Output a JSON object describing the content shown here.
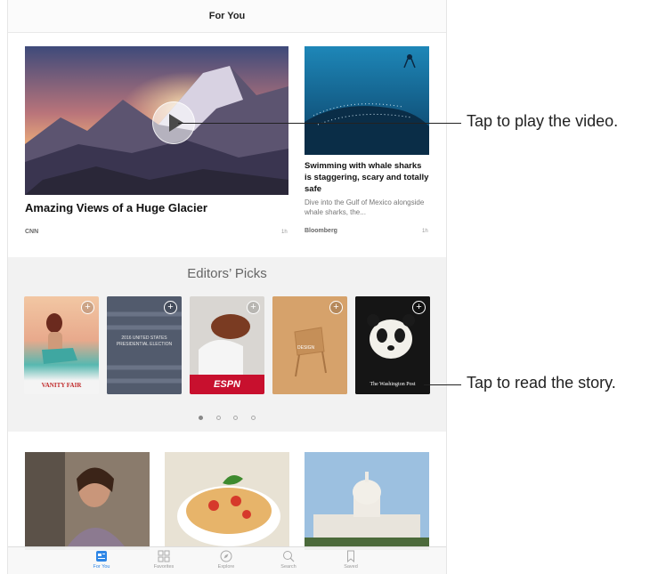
{
  "header": {
    "title": "For You"
  },
  "hero": {
    "title": "Amazing Views of a Huge Glacier",
    "source": "CNN",
    "time": "1h"
  },
  "side_story": {
    "title": "Swimming with whale sharks is staggering, scary and totally safe",
    "excerpt": "Dive into the Gulf of Mexico alongside whale sharks, the...",
    "source": "Bloomberg",
    "time": "1h"
  },
  "editors_picks": {
    "title": "Editors’ Picks",
    "covers": [
      {
        "brand": "VANITY FAIR"
      },
      {
        "brand": "2016 UNITED STATES PRESIDENTIAL ELECTION"
      },
      {
        "brand": "ESPN"
      },
      {
        "brand": "DESIGN"
      },
      {
        "brand": "The Washington Post"
      }
    ],
    "page_count": 4,
    "current_page": 1
  },
  "tabs": [
    {
      "label": "For You",
      "icon": "for-you-icon",
      "active": true
    },
    {
      "label": "Favorites",
      "icon": "favorites-grid-icon",
      "active": false
    },
    {
      "label": "Explore",
      "icon": "compass-icon",
      "active": false
    },
    {
      "label": "Search",
      "icon": "search-icon",
      "active": false
    },
    {
      "label": "Saved",
      "icon": "bookmark-icon",
      "active": false
    }
  ],
  "callouts": {
    "play": "Tap to play the video.",
    "read": "Tap to read the story."
  },
  "colors": {
    "accent": "#2e86e6",
    "espn_red": "#c8102e"
  }
}
